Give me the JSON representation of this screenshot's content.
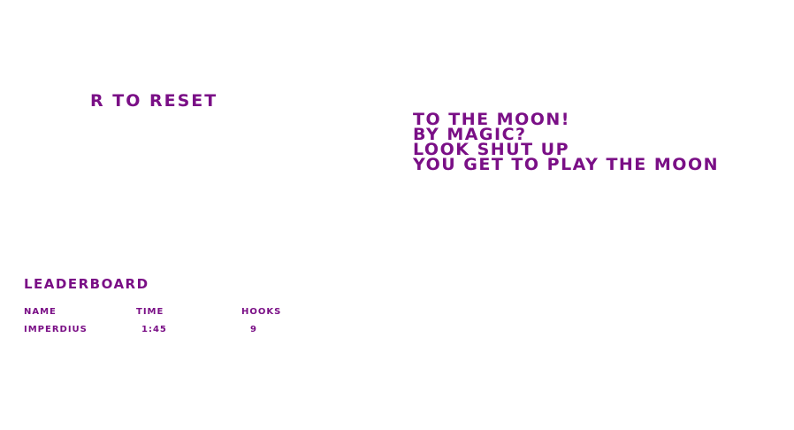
{
  "hint": "R to reset",
  "story_lines": [
    "To the moon!",
    "by magic?",
    "look shut up",
    "you get to play the moon"
  ],
  "leaderboard": {
    "title": "Leaderboard",
    "headers": [
      "Name",
      "Time",
      "Hooks"
    ],
    "rows": [
      [
        "Imperdius",
        "1:45",
        "9"
      ]
    ]
  },
  "colors": {
    "text": "#7a0f86",
    "background": "#ffffff"
  }
}
